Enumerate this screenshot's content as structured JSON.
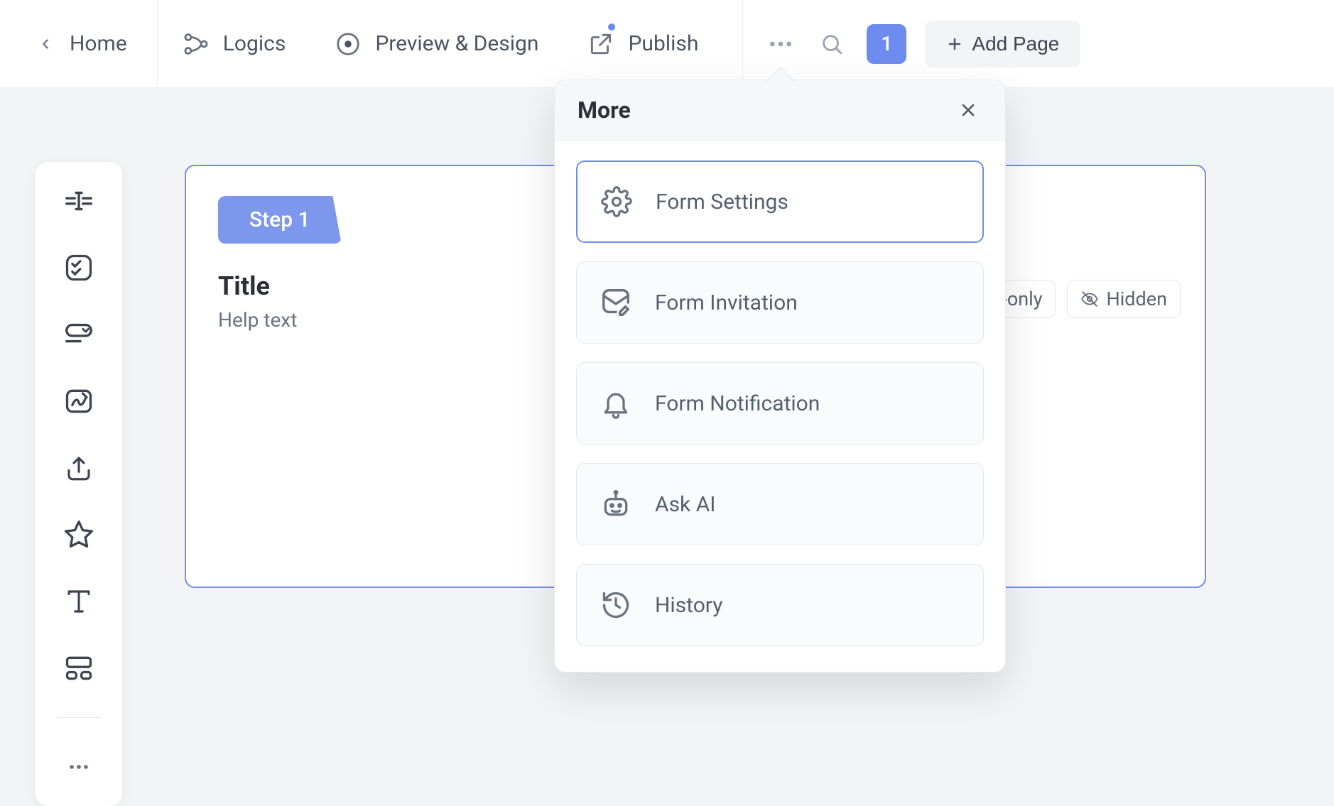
{
  "nav": {
    "home": "Home",
    "logics": "Logics",
    "preview": "Preview & Design",
    "publish": "Publish",
    "page_number": "1",
    "add_page": "Add Page"
  },
  "canvas": {
    "step_label": "Step 1",
    "title": "Title",
    "help": "Help text",
    "tags": {
      "readonly": "d-only",
      "hidden": "Hidden"
    }
  },
  "popover": {
    "title": "More",
    "items": {
      "settings": "Form Settings",
      "invitation": "Form Invitation",
      "notification": "Form Notification",
      "ask_ai": "Ask AI",
      "history": "History"
    }
  }
}
